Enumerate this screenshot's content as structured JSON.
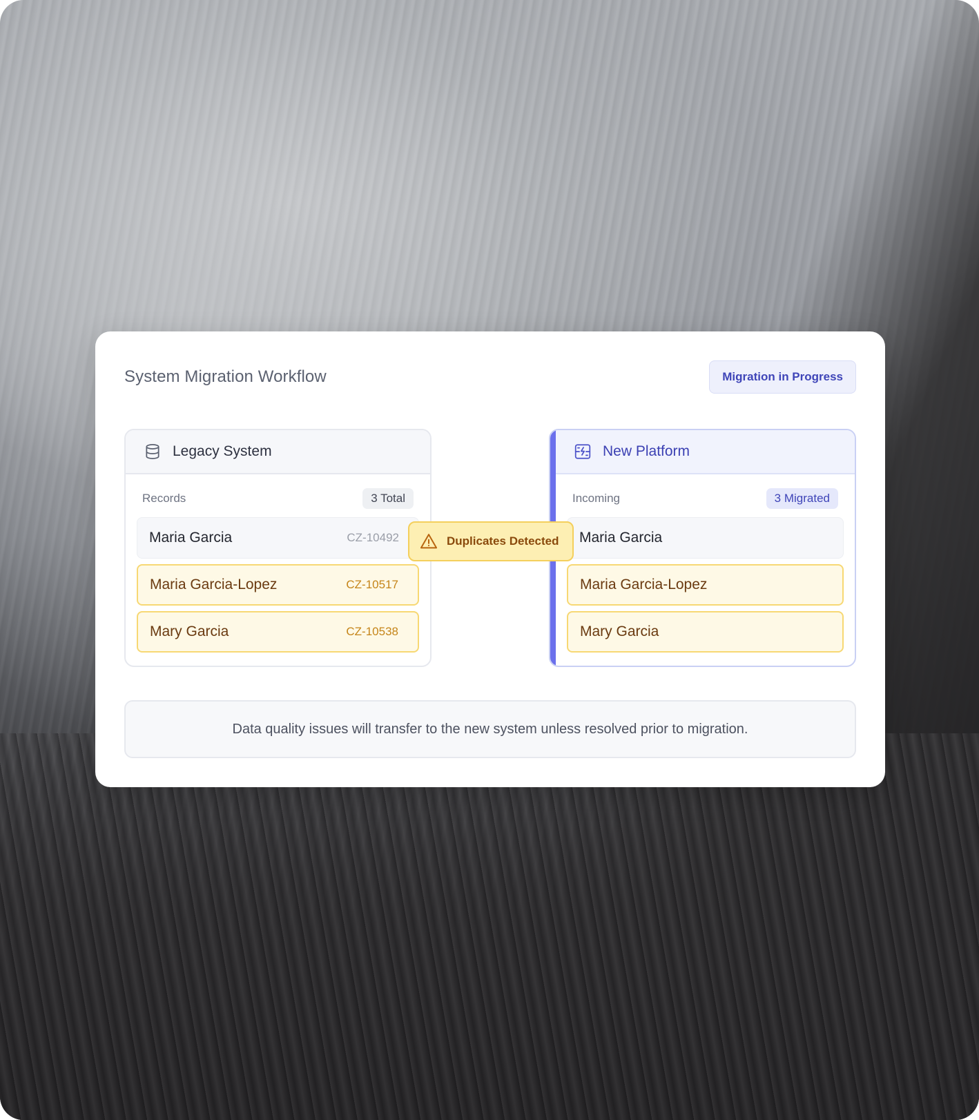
{
  "card": {
    "title": "System Migration Workflow",
    "status": "Migration in Progress"
  },
  "legacy": {
    "title": "Legacy System",
    "icon": "database-icon",
    "sub_label": "Records",
    "count": "3 Total",
    "records": [
      {
        "name": "Maria Garcia",
        "code": "CZ-10492",
        "duplicate": false
      },
      {
        "name": "Maria Garcia-Lopez",
        "code": "CZ-10517",
        "duplicate": true
      },
      {
        "name": "Mary Garcia",
        "code": "CZ-10538",
        "duplicate": true
      }
    ]
  },
  "platform": {
    "title": "New Platform",
    "icon": "platform-transfer-icon",
    "sub_label": "Incoming",
    "count": "3 Migrated",
    "records": [
      {
        "name": "Maria Garcia",
        "duplicate": false
      },
      {
        "name": "Maria Garcia-Lopez",
        "duplicate": true
      },
      {
        "name": "Mary Garcia",
        "duplicate": true
      }
    ]
  },
  "alert": {
    "label": "Duplicates Detected",
    "icon": "warning-icon"
  },
  "note": {
    "text": "Data quality issues will transfer to the new system unless resolved prior to migration."
  },
  "colors": {
    "accent": "#6b70ec",
    "accent_text": "#3f45b8",
    "warning_bg": "#fef9e6",
    "warning_border": "#f7d873"
  }
}
